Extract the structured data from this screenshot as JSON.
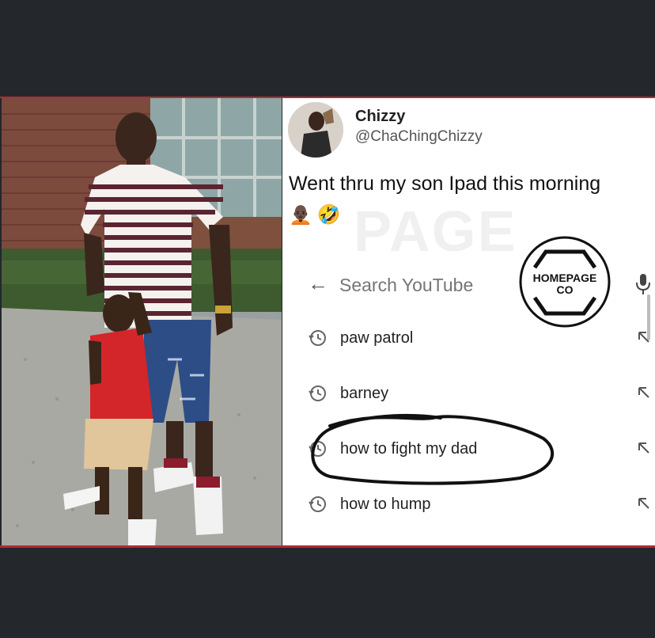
{
  "tweet": {
    "display_name": "Chizzy",
    "handle": "@ChaChingChizzy",
    "text": "Went thru my son Ipad this morning",
    "emojis": [
      "🧑🏿‍🦲",
      "🤣"
    ]
  },
  "youtube": {
    "search_placeholder": "Search YouTube",
    "suggestions": [
      {
        "label": "paw patrol"
      },
      {
        "label": "barney"
      },
      {
        "label": "how to fight my dad",
        "circled": true
      },
      {
        "label": "how to hump"
      }
    ]
  },
  "watermark": {
    "background_text": "PAGE",
    "logo_line1": "HOMEPAGE",
    "logo_line2": "CO"
  },
  "colors": {
    "frame_dark": "#24282c",
    "accent_red": "#b72a30",
    "marker_black": "#111111"
  },
  "icons": {
    "back": "back-arrow-icon",
    "mic": "mic-icon",
    "history": "history-clock-icon",
    "fill_query": "arrow-up-left-icon"
  }
}
